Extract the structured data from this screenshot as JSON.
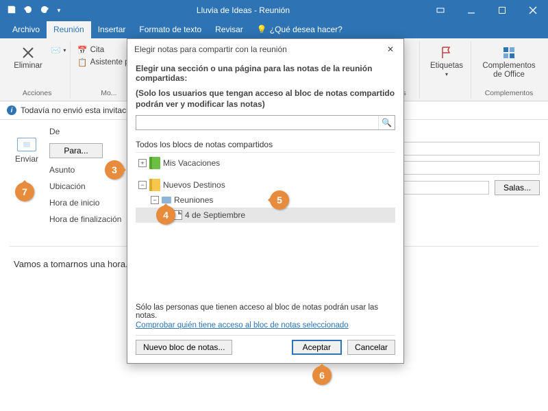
{
  "titlebar": {
    "title": "Lluvia de Ideas  -  Reunión"
  },
  "tabs": {
    "archivo": "Archivo",
    "reunion": "Reunión",
    "insertar": "Insertar",
    "formato": "Formato de texto",
    "revisar": "Revisar",
    "tellme_placeholder": "¿Qué desea hacer?"
  },
  "ribbon": {
    "eliminar": "Eliminar",
    "acciones_label": "Acciones",
    "cita": "Cita",
    "asistente": "Asistente pa...",
    "mostrar_label": "Mo...",
    "ones": "...ones",
    "etiquetas": "Etiquetas",
    "complementos": "Complementos\nde Office",
    "complementos_label": "Complementos"
  },
  "infobar": {
    "text": "Todavía no envió esta invitaci..."
  },
  "form": {
    "de": "De",
    "para_btn": "Para...",
    "asunto": "Asunto",
    "ubicacion": "Ubicación",
    "hora_inicio": "Hora de inicio",
    "hora_fin": "Hora de finalización",
    "enviar": "Enviar",
    "salas": "Salas..."
  },
  "body": {
    "text": "Vamos a tomarnos una hora..."
  },
  "dialog": {
    "title": "Elegir notas para compartir con la reunión",
    "subtitle": "Elegir una sección o una página para las notas de la reunión compartidas:",
    "note": "(Solo los usuarios que tengan acceso al bloc de notas compartido podrán ver y modificar las notas)",
    "section_head": "Todos los blocs de notas compartidos",
    "nb1": "Mis Vacaciones",
    "nb2": "Nuevos Destinos",
    "sec1": "Reuniones",
    "page1": "4 de Septiembre",
    "access_text": "Sólo las personas que tienen acceso al bloc de notas podrán usar las notas.",
    "check_link": "Comprobar quién tiene acceso al bloc de notas seleccionado",
    "new_nb": "Nuevo bloc de notas...",
    "ok": "Aceptar",
    "cancel": "Cancelar"
  },
  "callouts": {
    "c3": "3",
    "c4": "4",
    "c5": "5",
    "c6": "6",
    "c7": "7"
  }
}
